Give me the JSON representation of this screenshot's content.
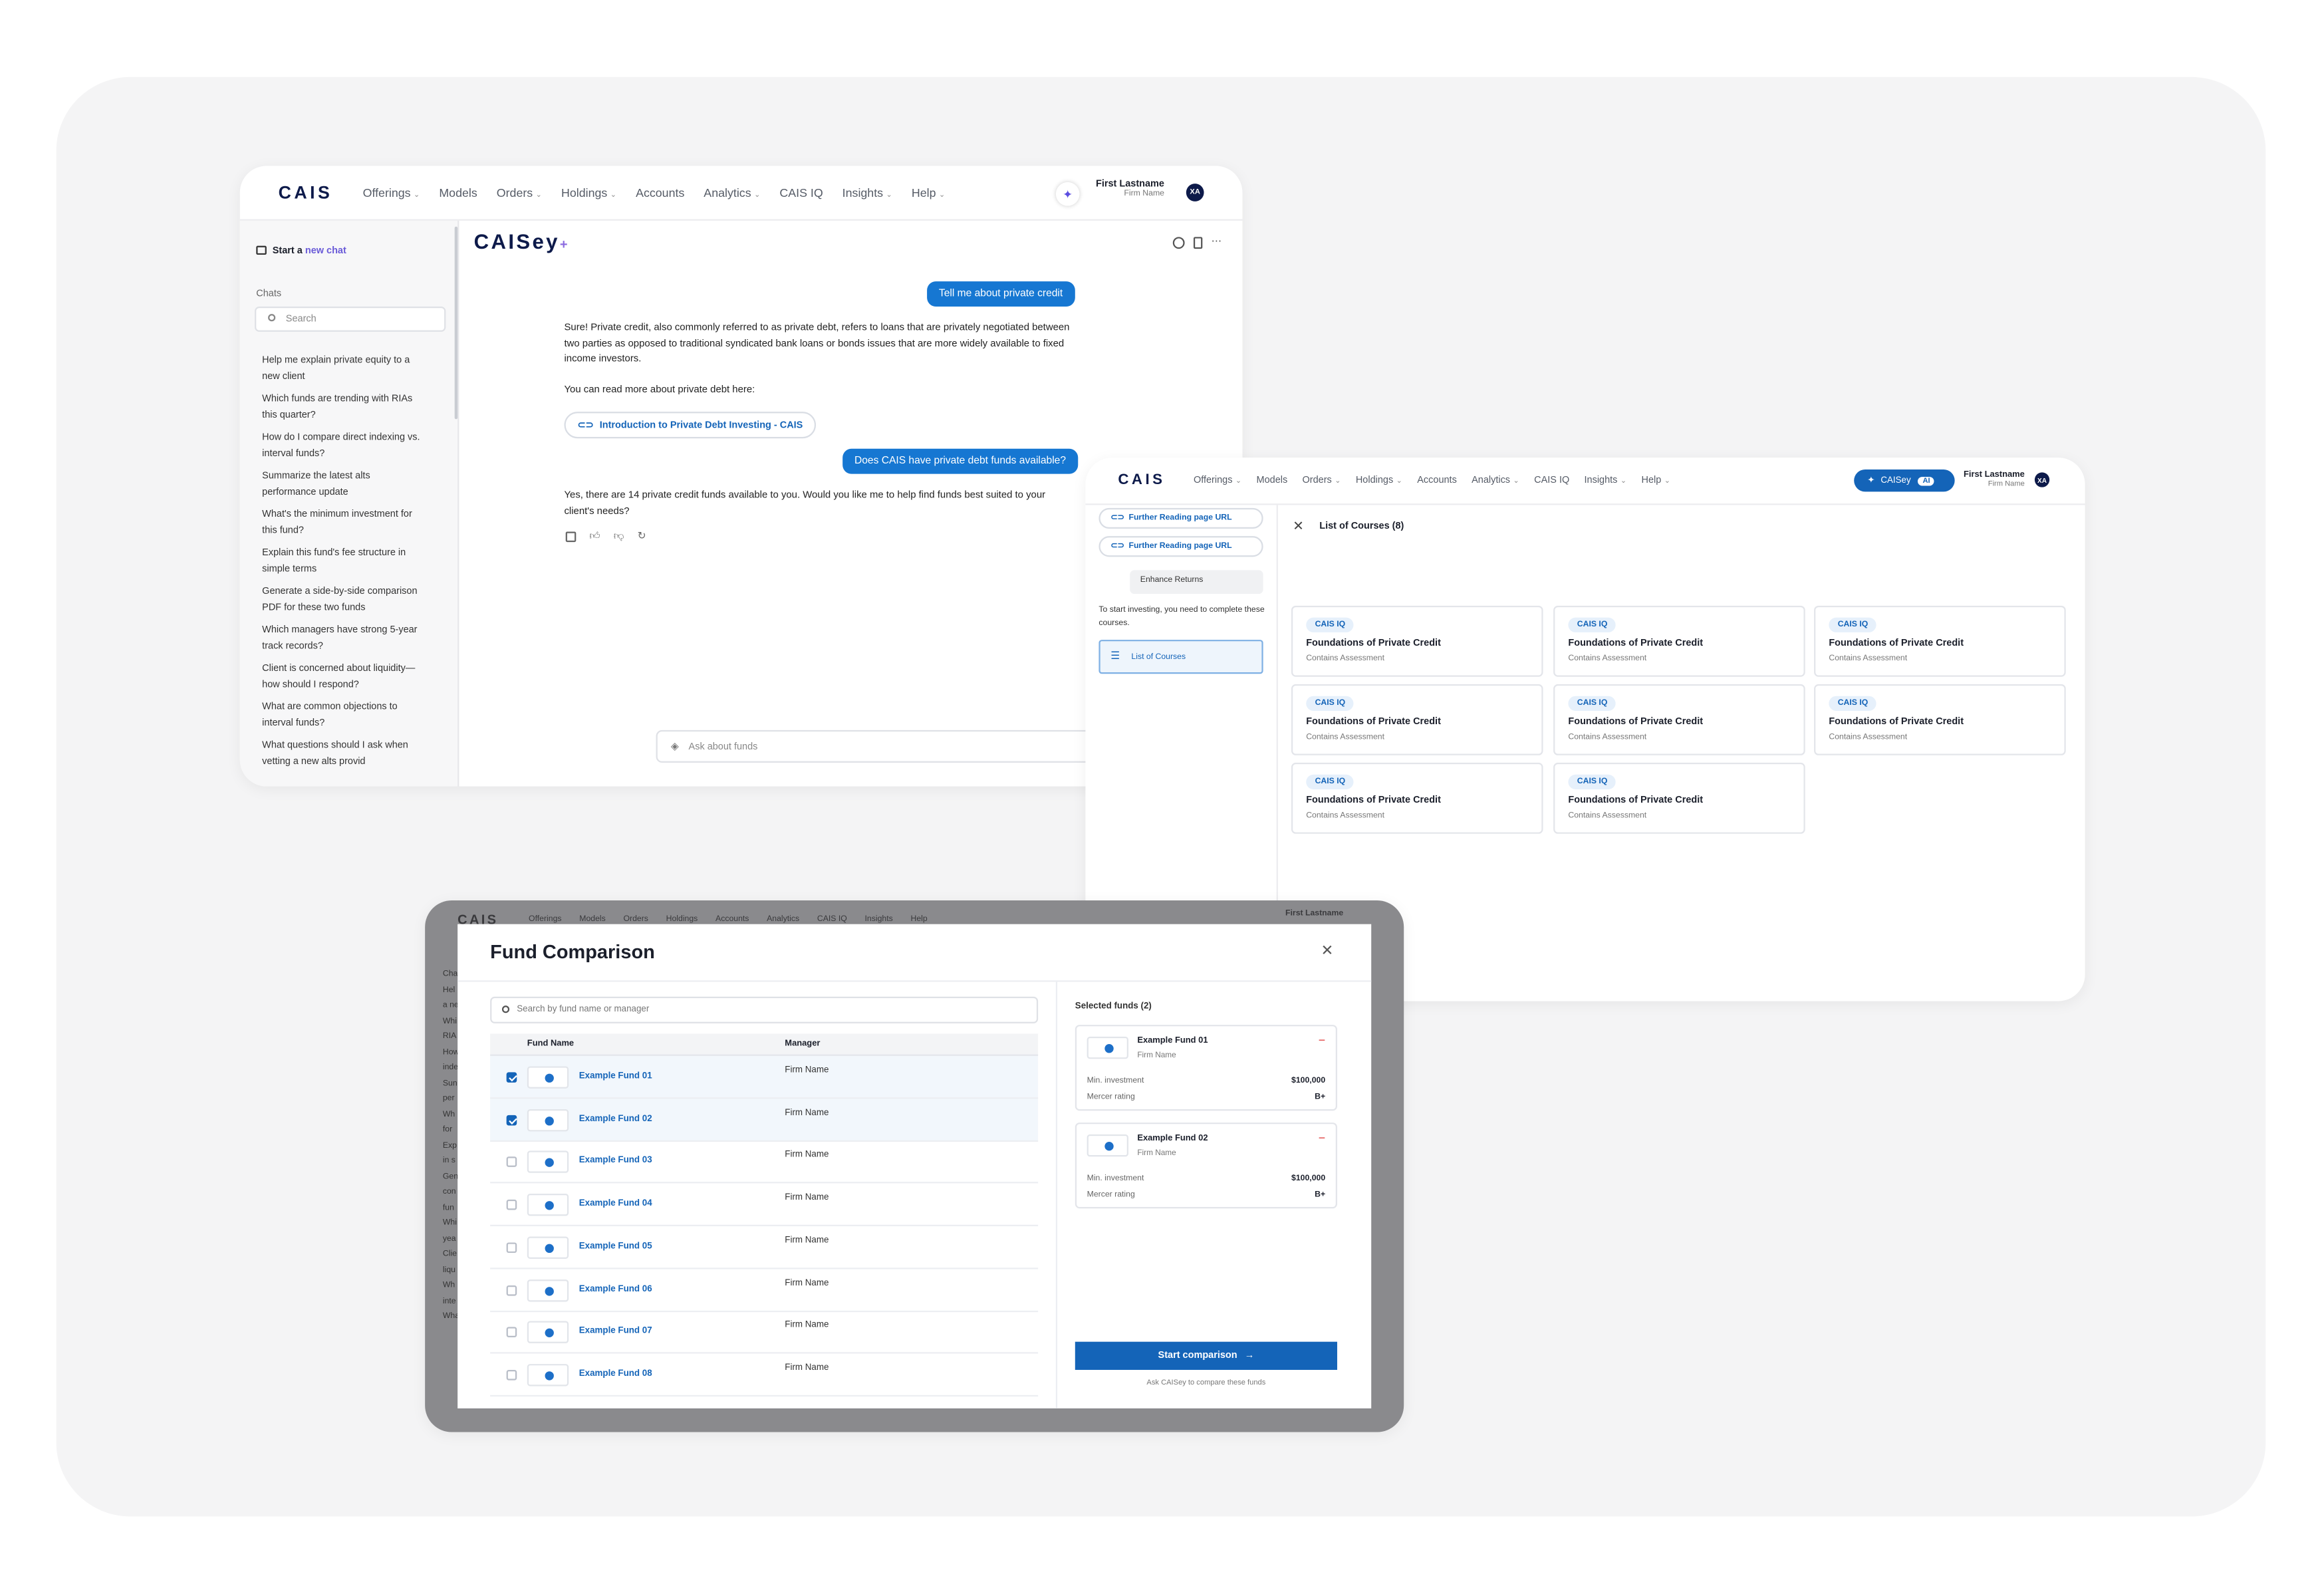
{
  "chat_window": {
    "nav": {
      "logo": "CAIS",
      "items": [
        "Offerings",
        "Models",
        "Orders",
        "Holdings",
        "Accounts",
        "Analytics",
        "CAIS IQ",
        "Insights",
        "Help"
      ],
      "user_name": "First Lastname",
      "firm": "Firm Name",
      "avatar": "XA"
    },
    "sidebar": {
      "new_chat_prefix": "Start a",
      "new_chat_highlight": "new chat",
      "chats_label": "Chats",
      "search_placeholder": "Search",
      "chats": [
        "Help me explain private equity to a new client",
        "Which funds are trending with RIAs this quarter?",
        "How do I compare direct indexing vs. interval funds?",
        "Summarize the latest alts performance update",
        "What's the minimum investment for this fund?",
        "Explain this fund's fee structure in simple terms",
        "Generate a side-by-side comparison PDF for these two funds",
        "Which managers have strong 5-year track records?",
        "Client is concerned about liquidity—how should I respond?",
        "What are common objections to interval funds?",
        "What questions should I ask when vetting a new alts provid"
      ]
    },
    "brand": "CAISey",
    "brand_plus": "+",
    "msg1": "Tell me about private credit",
    "reply1": "Sure! Private credit, also commonly referred to as private debt, refers to loans that are privately negotiated between two parties as opposed to traditional syndicated bank loans or bonds issues that are more widely available to fixed income investors.",
    "reply1b": "You can read more about private debt here:",
    "link": "Introduction to Private Debt Investing - CAIS",
    "msg2": "Does CAIS have private debt funds available?",
    "reply2": "Yes, there are 14 private credit funds available to you. Would you like me to help find funds best suited to your client's needs?",
    "input_placeholder": "Ask about funds"
  },
  "courses_window": {
    "nav": {
      "logo": "CAIS",
      "items": [
        "Offerings",
        "Models",
        "Orders",
        "Holdings",
        "Accounts",
        "Analytics",
        "CAIS IQ",
        "Insights",
        "Help"
      ],
      "caisey_label": "CAISey",
      "ai_badge": "AI",
      "user_name": "First Lastname",
      "firm": "Firm Name",
      "avatar": "XA"
    },
    "links": [
      "Further Reading page URL",
      "Further Reading page URL"
    ],
    "enhance": "Enhance Returns",
    "start_text": "To start investing, you need to complete these courses.",
    "list_button": "List of Courses",
    "panel_title": "List of Courses (8)",
    "courses": [
      {
        "tag": "CAIS IQ",
        "title": "Foundations of Private Credit",
        "sub": "Contains Assessment"
      },
      {
        "tag": "CAIS IQ",
        "title": "Foundations of Private Credit",
        "sub": "Contains Assessment"
      },
      {
        "tag": "CAIS IQ",
        "title": "Foundations of Private Credit",
        "sub": "Contains Assessment"
      },
      {
        "tag": "CAIS IQ",
        "title": "Foundations of Private Credit",
        "sub": "Contains Assessment"
      },
      {
        "tag": "CAIS IQ",
        "title": "Foundations of Private Credit",
        "sub": "Contains Assessment"
      },
      {
        "tag": "CAIS IQ",
        "title": "Foundations of Private Credit",
        "sub": "Contains Assessment"
      },
      {
        "tag": "CAIS IQ",
        "title": "Foundations of Private Credit",
        "sub": "Contains Assessment"
      },
      {
        "tag": "CAIS IQ",
        "title": "Foundations of Private Credit",
        "sub": "Contains Assessment"
      }
    ]
  },
  "comparison_window": {
    "bg_nav": {
      "logo": "CAIS",
      "items": [
        "Offerings",
        "Models",
        "Orders",
        "Holdings",
        "Accounts",
        "Analytics",
        "CAIS IQ",
        "Insights",
        "Help"
      ],
      "user_name": "First Lastname"
    },
    "bg_side": [
      "Cha",
      "Hel",
      "a ne",
      "Whi",
      "RIA",
      "How",
      "inde",
      "Sun",
      "per",
      "Wh",
      "for",
      "Exp",
      "in s",
      "Gen",
      "con",
      "fun",
      "Whi",
      "yea",
      "Clie",
      "liqu",
      "Wh",
      "inte",
      "What questions should I ask"
    ],
    "title": "Fund Comparison",
    "search_placeholder": "Search by fund name or manager",
    "col_fund": "Fund Name",
    "col_manager": "Manager",
    "funds": [
      {
        "name": "Example Fund 01",
        "manager": "Firm Name",
        "checked": true
      },
      {
        "name": "Example Fund 02",
        "manager": "Firm Name",
        "checked": true
      },
      {
        "name": "Example Fund 03",
        "manager": "Firm Name",
        "checked": false
      },
      {
        "name": "Example Fund 04",
        "manager": "Firm Name",
        "checked": false
      },
      {
        "name": "Example Fund 05",
        "manager": "Firm Name",
        "checked": false
      },
      {
        "name": "Example Fund 06",
        "manager": "Firm Name",
        "checked": false
      },
      {
        "name": "Example Fund 07",
        "manager": "Firm Name",
        "checked": false
      },
      {
        "name": "Example Fund 08",
        "manager": "Firm Name",
        "checked": false
      }
    ],
    "selected_label": "Selected funds (2)",
    "selected": [
      {
        "name": "Example Fund 01",
        "firm": "Firm Name",
        "min_label": "Min. investment",
        "min": "$100,000",
        "rating_label": "Mercer rating",
        "rating": "B+"
      },
      {
        "name": "Example Fund 02",
        "firm": "Firm Name",
        "min_label": "Min. investment",
        "min": "$100,000",
        "rating_label": "Mercer rating",
        "rating": "B+"
      }
    ],
    "start_button": "Start comparison",
    "hint": "Ask CAISey to compare these funds"
  }
}
